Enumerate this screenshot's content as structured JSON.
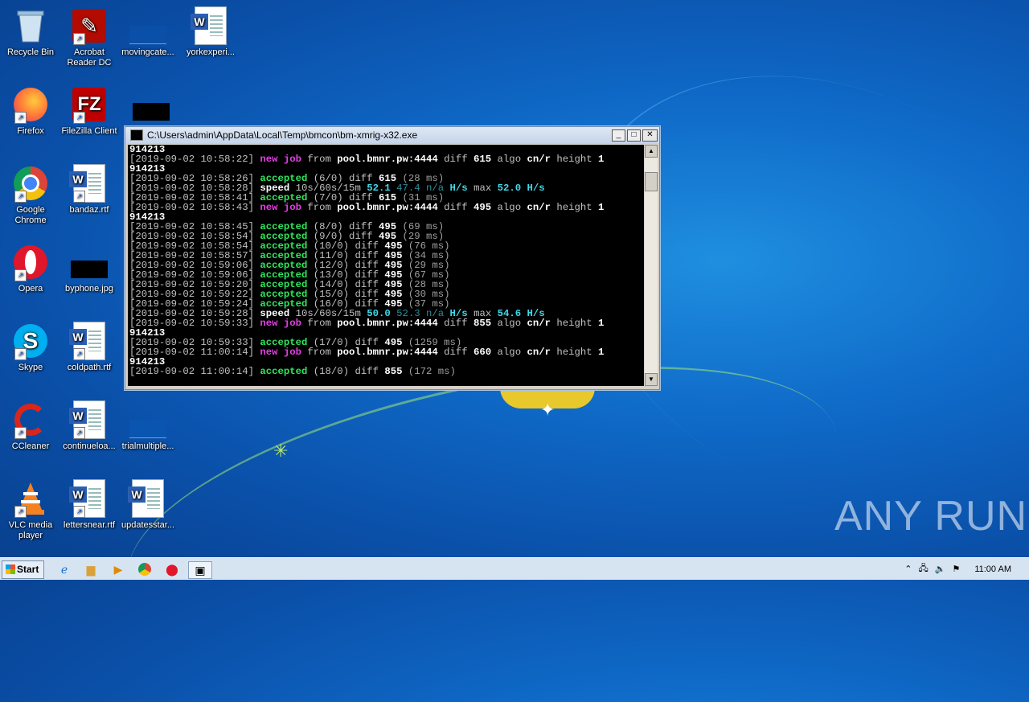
{
  "desktop": {
    "icons": [
      {
        "label": "Recycle Bin"
      },
      {
        "label": "Acrobat Reader DC"
      },
      {
        "label": "movingcate..."
      },
      {
        "label": "yorkexperi..."
      },
      {
        "label": "Firefox"
      },
      {
        "label": "FileZilla Client"
      },
      {
        "label": "Google Chrome"
      },
      {
        "label": "bandaz.rtf"
      },
      {
        "label": "Opera"
      },
      {
        "label": "byphone.jpg"
      },
      {
        "label": "Skype"
      },
      {
        "label": "coldpath.rtf"
      },
      {
        "label": "CCleaner"
      },
      {
        "label": "continueloa..."
      },
      {
        "label": "trialmultiple..."
      },
      {
        "label": "VLC media player"
      },
      {
        "label": "lettersnear.rtf"
      },
      {
        "label": "updatesstar..."
      }
    ]
  },
  "window": {
    "title": "C:\\Users\\admin\\AppData\\Local\\Temp\\bmcon\\bm-xmrig-x32.exe",
    "minimize": "_",
    "maximize": "□",
    "close": "✕"
  },
  "console": {
    "lines": [
      [
        {
          "t": "914213",
          "c": "w"
        }
      ],
      [
        {
          "t": "[2019-09-02 10:58:22] ",
          "c": ""
        },
        {
          "t": "new job",
          "c": "m"
        },
        {
          "t": " from ",
          "c": ""
        },
        {
          "t": "pool.bmnr.pw:4444",
          "c": "w"
        },
        {
          "t": " diff ",
          "c": ""
        },
        {
          "t": "615",
          "c": "w"
        },
        {
          "t": " algo ",
          "c": ""
        },
        {
          "t": "cn/r",
          "c": "w"
        },
        {
          "t": " height ",
          "c": ""
        },
        {
          "t": "1",
          "c": "w"
        }
      ],
      [
        {
          "t": "914213",
          "c": "w"
        }
      ],
      [
        {
          "t": "[2019-09-02 10:58:26] ",
          "c": ""
        },
        {
          "t": "accepted",
          "c": "g"
        },
        {
          "t": " (6/0) diff ",
          "c": ""
        },
        {
          "t": "615",
          "c": "w"
        },
        {
          "t": " (28 ms)",
          "c": "s"
        }
      ],
      [
        {
          "t": "[2019-09-02 10:58:28] ",
          "c": ""
        },
        {
          "t": "speed",
          "c": "w"
        },
        {
          "t": " 10s/60s/15m ",
          "c": ""
        },
        {
          "t": "52.1",
          "c": "c"
        },
        {
          "t": " 47.4 n/a",
          "c": "t"
        },
        {
          "t": " H/s",
          "c": "c"
        },
        {
          "t": " max ",
          "c": ""
        },
        {
          "t": "52.0",
          "c": "c"
        },
        {
          "t": " H/s",
          "c": "c"
        }
      ],
      [
        {
          "t": "[2019-09-02 10:58:41] ",
          "c": ""
        },
        {
          "t": "accepted",
          "c": "g"
        },
        {
          "t": " (7/0) diff ",
          "c": ""
        },
        {
          "t": "615",
          "c": "w"
        },
        {
          "t": " (31 ms)",
          "c": "s"
        }
      ],
      [
        {
          "t": "[2019-09-02 10:58:43] ",
          "c": ""
        },
        {
          "t": "new job",
          "c": "m"
        },
        {
          "t": " from ",
          "c": ""
        },
        {
          "t": "pool.bmnr.pw:4444",
          "c": "w"
        },
        {
          "t": " diff ",
          "c": ""
        },
        {
          "t": "495",
          "c": "w"
        },
        {
          "t": " algo ",
          "c": ""
        },
        {
          "t": "cn/r",
          "c": "w"
        },
        {
          "t": " height ",
          "c": ""
        },
        {
          "t": "1",
          "c": "w"
        }
      ],
      [
        {
          "t": "914213",
          "c": "w"
        }
      ],
      [
        {
          "t": "[2019-09-02 10:58:45] ",
          "c": ""
        },
        {
          "t": "accepted",
          "c": "g"
        },
        {
          "t": " (8/0) diff ",
          "c": ""
        },
        {
          "t": "495",
          "c": "w"
        },
        {
          "t": " (69 ms)",
          "c": "s"
        }
      ],
      [
        {
          "t": "[2019-09-02 10:58:54] ",
          "c": ""
        },
        {
          "t": "accepted",
          "c": "g"
        },
        {
          "t": " (9/0) diff ",
          "c": ""
        },
        {
          "t": "495",
          "c": "w"
        },
        {
          "t": " (29 ms)",
          "c": "s"
        }
      ],
      [
        {
          "t": "[2019-09-02 10:58:54] ",
          "c": ""
        },
        {
          "t": "accepted",
          "c": "g"
        },
        {
          "t": " (10/0) diff ",
          "c": ""
        },
        {
          "t": "495",
          "c": "w"
        },
        {
          "t": " (76 ms)",
          "c": "s"
        }
      ],
      [
        {
          "t": "[2019-09-02 10:58:57] ",
          "c": ""
        },
        {
          "t": "accepted",
          "c": "g"
        },
        {
          "t": " (11/0) diff ",
          "c": ""
        },
        {
          "t": "495",
          "c": "w"
        },
        {
          "t": " (34 ms)",
          "c": "s"
        }
      ],
      [
        {
          "t": "[2019-09-02 10:59:06] ",
          "c": ""
        },
        {
          "t": "accepted",
          "c": "g"
        },
        {
          "t": " (12/0) diff ",
          "c": ""
        },
        {
          "t": "495",
          "c": "w"
        },
        {
          "t": " (29 ms)",
          "c": "s"
        }
      ],
      [
        {
          "t": "[2019-09-02 10:59:06] ",
          "c": ""
        },
        {
          "t": "accepted",
          "c": "g"
        },
        {
          "t": " (13/0) diff ",
          "c": ""
        },
        {
          "t": "495",
          "c": "w"
        },
        {
          "t": " (67 ms)",
          "c": "s"
        }
      ],
      [
        {
          "t": "[2019-09-02 10:59:20] ",
          "c": ""
        },
        {
          "t": "accepted",
          "c": "g"
        },
        {
          "t": " (14/0) diff ",
          "c": ""
        },
        {
          "t": "495",
          "c": "w"
        },
        {
          "t": " (28 ms)",
          "c": "s"
        }
      ],
      [
        {
          "t": "[2019-09-02 10:59:22] ",
          "c": ""
        },
        {
          "t": "accepted",
          "c": "g"
        },
        {
          "t": " (15/0) diff ",
          "c": ""
        },
        {
          "t": "495",
          "c": "w"
        },
        {
          "t": " (30 ms)",
          "c": "s"
        }
      ],
      [
        {
          "t": "[2019-09-02 10:59:24] ",
          "c": ""
        },
        {
          "t": "accepted",
          "c": "g"
        },
        {
          "t": " (16/0) diff ",
          "c": ""
        },
        {
          "t": "495",
          "c": "w"
        },
        {
          "t": " (37 ms)",
          "c": "s"
        }
      ],
      [
        {
          "t": "[2019-09-02 10:59:28] ",
          "c": ""
        },
        {
          "t": "speed",
          "c": "w"
        },
        {
          "t": " 10s/60s/15m ",
          "c": ""
        },
        {
          "t": "50.0",
          "c": "c"
        },
        {
          "t": " 52.3 n/a",
          "c": "t"
        },
        {
          "t": " H/s",
          "c": "c"
        },
        {
          "t": " max ",
          "c": ""
        },
        {
          "t": "54.6",
          "c": "c"
        },
        {
          "t": " H/s",
          "c": "c"
        }
      ],
      [
        {
          "t": "[2019-09-02 10:59:33] ",
          "c": ""
        },
        {
          "t": "new job",
          "c": "m"
        },
        {
          "t": " from ",
          "c": ""
        },
        {
          "t": "pool.bmnr.pw:4444",
          "c": "w"
        },
        {
          "t": " diff ",
          "c": ""
        },
        {
          "t": "855",
          "c": "w"
        },
        {
          "t": " algo ",
          "c": ""
        },
        {
          "t": "cn/r",
          "c": "w"
        },
        {
          "t": " height ",
          "c": ""
        },
        {
          "t": "1",
          "c": "w"
        }
      ],
      [
        {
          "t": "914213",
          "c": "w"
        }
      ],
      [
        {
          "t": "[2019-09-02 10:59:33] ",
          "c": ""
        },
        {
          "t": "accepted",
          "c": "g"
        },
        {
          "t": " (17/0) diff ",
          "c": ""
        },
        {
          "t": "495",
          "c": "w"
        },
        {
          "t": " (1259 ms)",
          "c": "s"
        }
      ],
      [
        {
          "t": "[2019-09-02 11:00:14] ",
          "c": ""
        },
        {
          "t": "new job",
          "c": "m"
        },
        {
          "t": " from ",
          "c": ""
        },
        {
          "t": "pool.bmnr.pw:4444",
          "c": "w"
        },
        {
          "t": " diff ",
          "c": ""
        },
        {
          "t": "660",
          "c": "w"
        },
        {
          "t": " algo ",
          "c": ""
        },
        {
          "t": "cn/r",
          "c": "w"
        },
        {
          "t": " height ",
          "c": ""
        },
        {
          "t": "1",
          "c": "w"
        }
      ],
      [
        {
          "t": "914213",
          "c": "w"
        }
      ],
      [
        {
          "t": "[2019-09-02 11:00:14] ",
          "c": ""
        },
        {
          "t": "accepted",
          "c": "g"
        },
        {
          "t": " (18/0) diff ",
          "c": ""
        },
        {
          "t": "855",
          "c": "w"
        },
        {
          "t": " (172 ms)",
          "c": "s"
        }
      ]
    ]
  },
  "taskbar": {
    "start_label": "Start",
    "clock": "11:00 AM"
  },
  "watermark": "ANY RUN"
}
